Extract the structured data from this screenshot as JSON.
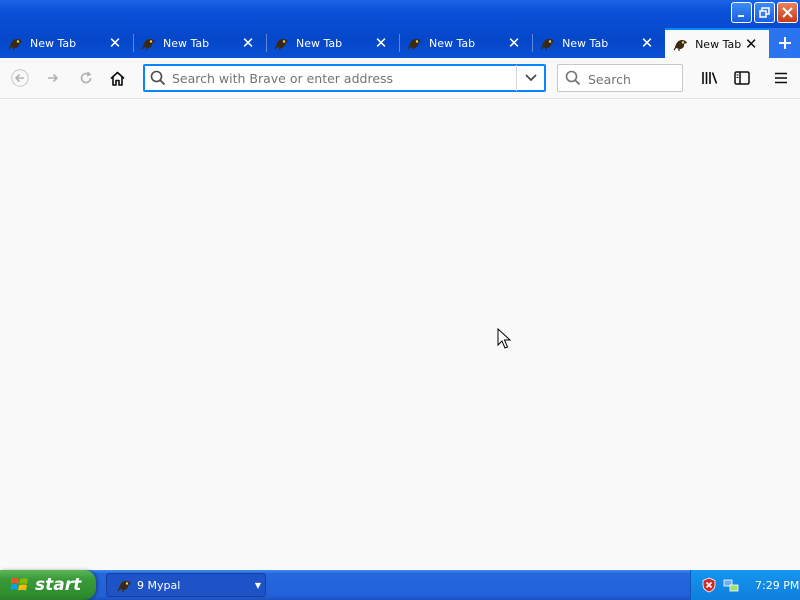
{
  "window": {
    "controls": [
      "minimize",
      "restore",
      "close"
    ]
  },
  "tabs": [
    {
      "label": "New Tab",
      "active": false
    },
    {
      "label": "New Tab",
      "active": false
    },
    {
      "label": "New Tab",
      "active": false
    },
    {
      "label": "New Tab",
      "active": false
    },
    {
      "label": "New Tab",
      "active": false
    },
    {
      "label": "New Tab",
      "active": true
    }
  ],
  "navbar": {
    "url_placeholder": "Search with Brave or enter address",
    "url_value": "",
    "search_placeholder": "Search"
  },
  "taskbar": {
    "start_label": "start",
    "task_label": "9 Mypal",
    "clock": "7:29 PM"
  },
  "colors": {
    "accent": "#0a84ff",
    "titlebar": "#0a50d8",
    "start_green": "#3a9a3a"
  }
}
